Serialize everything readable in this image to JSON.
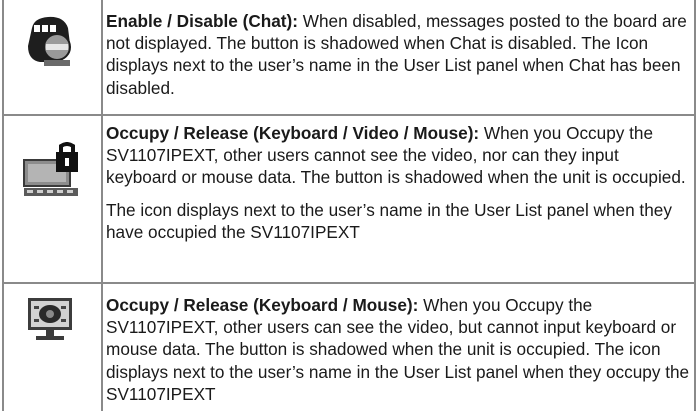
{
  "rows": [
    {
      "icon": "chat-disabled-icon",
      "title": "Enable / Disable (Chat):",
      "paragraphs": [
        " When disabled, messages posted to the board are not displayed. The button is shadowed when Chat is disabled. The Icon displays next to the user’s name in the User List panel when Chat has been disabled."
      ]
    },
    {
      "icon": "occupy-kvm-icon",
      "title": "Occupy / Release (Keyboard / Video / Mouse):",
      "paragraphs": [
        " When you Occupy the SV1107IPEXT, other users cannot see the video, nor can they input keyboard or mouse data. The button is shadowed when the unit is occupied.",
        "The icon displays next to the user’s name in the User List panel when they have occupied the SV1107IPEXT"
      ]
    },
    {
      "icon": "occupy-km-icon",
      "title": "Occupy / Release (Keyboard / Mouse):",
      "paragraphs": [
        " When you Occupy the SV1107IPEXT, other users can see the video, but cannot input keyboard or mouse data.  The button is shadowed when the unit is occupied. The icon displays next to the user’s name in the User List panel when they occupy the SV1107IPEXT"
      ]
    }
  ]
}
